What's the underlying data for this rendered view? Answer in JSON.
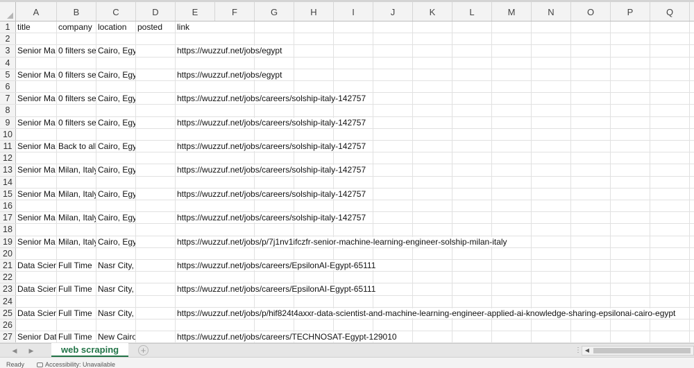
{
  "columns": [
    "A",
    "B",
    "C",
    "D",
    "E",
    "F",
    "G",
    "H",
    "I",
    "J",
    "K",
    "L",
    "M",
    "N",
    "O",
    "P",
    "Q"
  ],
  "rows": [
    {
      "n": "1",
      "cells": [
        "title",
        "company",
        "location",
        "posted",
        "link"
      ]
    },
    {
      "n": "2",
      "cells": [
        "",
        "",
        "",
        "",
        ""
      ]
    },
    {
      "n": "3",
      "cells": [
        "Senior Ma",
        "0 filters se",
        "Cairo, Egypt",
        "",
        "https://wuzzuf.net/jobs/egypt"
      ]
    },
    {
      "n": "4",
      "cells": [
        "",
        "",
        "",
        "",
        ""
      ]
    },
    {
      "n": "5",
      "cells": [
        "Senior Ma",
        "0 filters se",
        "Cairo, Egypt",
        "",
        "https://wuzzuf.net/jobs/egypt"
      ]
    },
    {
      "n": "6",
      "cells": [
        "",
        "",
        "",
        "",
        ""
      ]
    },
    {
      "n": "7",
      "cells": [
        "Senior Ma",
        "0 filters se",
        "Cairo, Egypt",
        "",
        "https://wuzzuf.net/jobs/careers/solship-italy-142757"
      ]
    },
    {
      "n": "8",
      "cells": [
        "",
        "",
        "",
        "",
        ""
      ]
    },
    {
      "n": "9",
      "cells": [
        "Senior Ma",
        "0 filters se",
        "Cairo, Egypt",
        "",
        "https://wuzzuf.net/jobs/careers/solship-italy-142757"
      ]
    },
    {
      "n": "10",
      "cells": [
        "",
        "",
        "",
        "",
        ""
      ]
    },
    {
      "n": "11",
      "cells": [
        "Senior Ma",
        "Back to all",
        "Cairo, Egypt",
        "",
        "https://wuzzuf.net/jobs/careers/solship-italy-142757"
      ]
    },
    {
      "n": "12",
      "cells": [
        "",
        "",
        "",
        "",
        ""
      ]
    },
    {
      "n": "13",
      "cells": [
        "Senior Ma",
        "Milan, Italy",
        "Cairo, Egypt",
        "",
        "https://wuzzuf.net/jobs/careers/solship-italy-142757"
      ]
    },
    {
      "n": "14",
      "cells": [
        "",
        "",
        "",
        "",
        ""
      ]
    },
    {
      "n": "15",
      "cells": [
        "Senior Ma",
        "Milan, Italy",
        "Cairo, Egypt",
        "",
        "https://wuzzuf.net/jobs/careers/solship-italy-142757"
      ]
    },
    {
      "n": "16",
      "cells": [
        "",
        "",
        "",
        "",
        ""
      ]
    },
    {
      "n": "17",
      "cells": [
        "Senior Ma",
        "Milan, Italy",
        "Cairo, Egypt",
        "",
        "https://wuzzuf.net/jobs/careers/solship-italy-142757"
      ]
    },
    {
      "n": "18",
      "cells": [
        "",
        "",
        "",
        "",
        ""
      ]
    },
    {
      "n": "19",
      "cells": [
        "Senior Ma",
        "Milan, Italy",
        "Cairo, Egypt",
        "",
        "https://wuzzuf.net/jobs/p/7j1nv1ifczfr-senior-machine-learning-engineer-solship-milan-italy"
      ]
    },
    {
      "n": "20",
      "cells": [
        "",
        "",
        "",
        "",
        ""
      ]
    },
    {
      "n": "21",
      "cells": [
        "Data Scien",
        "Full Time",
        "Nasr City, Cairo, Egypt",
        "",
        "https://wuzzuf.net/jobs/careers/EpsilonAI-Egypt-65111"
      ]
    },
    {
      "n": "22",
      "cells": [
        "",
        "",
        "",
        "",
        ""
      ]
    },
    {
      "n": "23",
      "cells": [
        "Data Scien",
        "Full Time",
        "Nasr City, Cairo, Egypt",
        "",
        "https://wuzzuf.net/jobs/careers/EpsilonAI-Egypt-65111"
      ]
    },
    {
      "n": "24",
      "cells": [
        "",
        "",
        "",
        "",
        ""
      ]
    },
    {
      "n": "25",
      "cells": [
        "Data Scientist And Ma",
        "Full Time",
        "Nasr City, Cairo, Egypt",
        "",
        "https://wuzzuf.net/jobs/p/hif824t4axxr-data-scientist-and-machine-learning-engineer-applied-ai-knowledge-sharing-epsilonai-cairo-egypt"
      ]
    },
    {
      "n": "26",
      "cells": [
        "",
        "",
        "",
        "",
        ""
      ]
    },
    {
      "n": "27",
      "cells": [
        "Senior Dat",
        "Full Time",
        "New Cairo, Cairo, Egypt",
        "",
        "https://wuzzuf.net/jobs/careers/TECHNOSAT-Egypt-129010"
      ]
    }
  ],
  "sheet_tab": "web scraping",
  "status": {
    "ready": "Ready",
    "accessibility": "Accessibility: Unavailable"
  },
  "icons": {
    "add_sheet": "plus-circle-icon",
    "prev": "triangle-left-icon",
    "next": "triangle-right-icon"
  },
  "colors": {
    "accent": "#217346"
  }
}
